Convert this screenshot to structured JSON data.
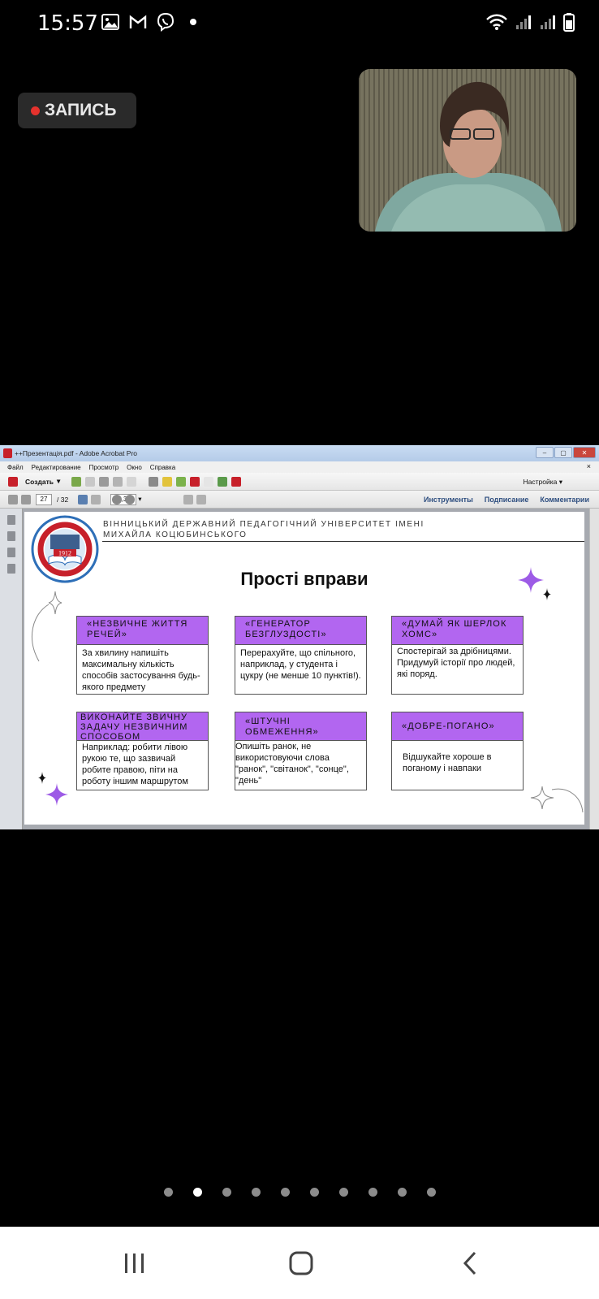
{
  "status": {
    "time": "15:57",
    "icons_left": [
      "image-icon",
      "gmail-icon",
      "viber-icon",
      "dot-icon"
    ],
    "icons_right": [
      "wifi-icon",
      "signal-icon",
      "signal-icon",
      "battery-icon"
    ]
  },
  "recording": {
    "label": "ЗАПИСЬ",
    "dot_color": "#e5322d"
  },
  "acrobat": {
    "window_title": "++Презентація.pdf - Adobe Acrobat Pro",
    "menu": [
      "Файл",
      "Редактирование",
      "Просмотр",
      "Окно",
      "Справка"
    ],
    "toolbar": {
      "create_label": "Создать",
      "settings_label": "Настройка",
      "page_current": "27",
      "page_total": "/ 32",
      "zoom": "58,3%",
      "tools_link": "Инструменты",
      "sign_link": "Подписание",
      "comments_link": "Комментарии"
    },
    "slide": {
      "university_line1": "ВІННИЦЬКИЙ ДЕРЖАВНИЙ ПЕДАГОГІЧНИЙ УНІВЕРСИТЕТ ІМЕНІ",
      "university_line2": "МИХАЙЛА КОЦЮБИНСЬКОГО",
      "logo_year": "1912",
      "title": "Прості вправи",
      "accent_color": "#b266f0",
      "cards": [
        {
          "head": "«НЕЗВИЧНЕ ЖИТТЯ РЕЧЕЙ»",
          "body": "За хвилину напишіть максимальну кількість способів застосування будь-якого предмету"
        },
        {
          "head": "«ГЕНЕРАТОР БЕЗГЛУЗДОСТІ»",
          "body": "Перерахуйте, що спільного, наприклад, у студента і цукру (не менше 10 пунктів!)."
        },
        {
          "head": "«ДУМАЙ ЯК ШЕРЛОК ХОМС»",
          "body": "Спостерігай за дрібницями.  Придумуй історії про людей, які поряд."
        },
        {
          "head": "ВИКОНАЙТЕ ЗВИЧНУ ЗАДАЧУ НЕЗВИЧНИМ СПОСОБОМ",
          "body": "Наприклад: робити лівою рукою те, що зазвичай робите правою, піти на роботу іншим маршрутом"
        },
        {
          "head": "«ШТУЧНІ ОБМЕЖЕННЯ»",
          "body": "Опишіть ранок, не використовуючи слова \"ранок\", \"світанок\", \"сонце\", \"день\""
        },
        {
          "head": "«ДОБРЕ-ПОГАНО»",
          "body": "Відшукайте хороше в поганому і навпаки"
        }
      ]
    }
  },
  "pager": {
    "total": 10,
    "active_index": 1
  },
  "navbar": {
    "icons": [
      "recent-apps-icon",
      "home-icon",
      "back-icon"
    ]
  }
}
